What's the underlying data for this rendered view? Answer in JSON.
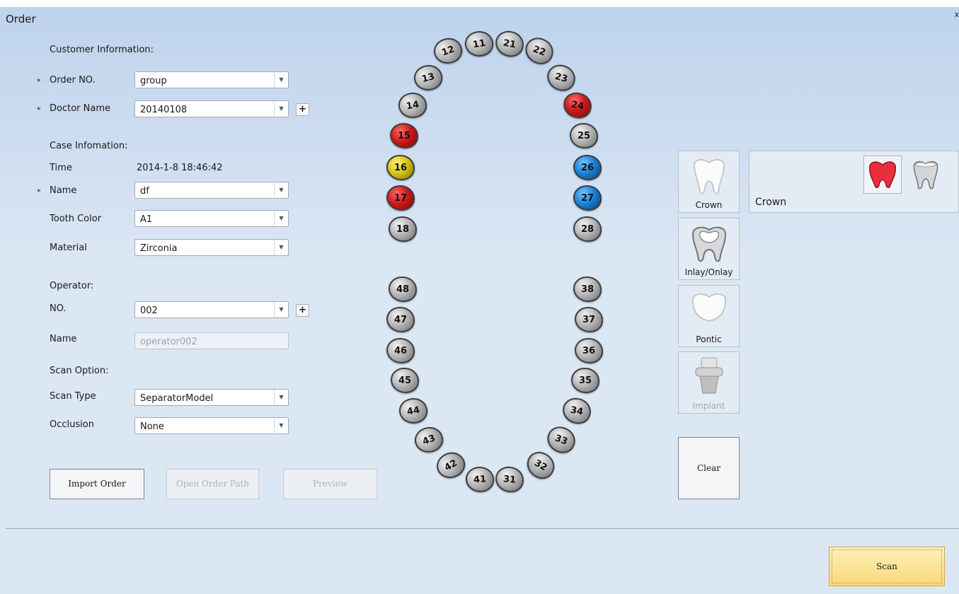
{
  "window": {
    "title": "Order",
    "close_label": "x"
  },
  "customer": {
    "section": "Customer Information:",
    "order_no_label": "Order NO.",
    "order_no_value": "group",
    "doctor_label": "Doctor Name",
    "doctor_value": "20140108"
  },
  "case": {
    "section": "Case Infomation:",
    "time_label": "Time",
    "time_value": "2014-1-8 18:46:42",
    "name_label": "Name",
    "name_value": "df",
    "tooth_color_label": "Tooth Color",
    "tooth_color_value": "A1",
    "material_label": "Material",
    "material_value": "Zirconia"
  },
  "operator": {
    "section": "Operator:",
    "no_label": "NO.",
    "no_value": "002",
    "name_label": "Name",
    "name_value": "operator002"
  },
  "scan_option": {
    "section": "Scan Option:",
    "type_label": "Scan Type",
    "type_value": "SeparatorModel",
    "occlusion_label": "Occlusion",
    "occlusion_value": "None"
  },
  "symbols": {
    "required": "*",
    "plus": "+",
    "dropdown": "▼"
  },
  "buttons": {
    "import": "Import Order",
    "open_path": "Open Order Path",
    "preview": "Preview",
    "clear": "Clear",
    "scan": "Scan"
  },
  "teeth": [
    {
      "n": "11",
      "state": "normal"
    },
    {
      "n": "12",
      "state": "normal"
    },
    {
      "n": "13",
      "state": "normal"
    },
    {
      "n": "14",
      "state": "normal"
    },
    {
      "n": "15",
      "state": "red"
    },
    {
      "n": "16",
      "state": "yellow"
    },
    {
      "n": "17",
      "state": "red"
    },
    {
      "n": "18",
      "state": "normal"
    },
    {
      "n": "21",
      "state": "normal"
    },
    {
      "n": "22",
      "state": "normal"
    },
    {
      "n": "23",
      "state": "normal"
    },
    {
      "n": "24",
      "state": "red"
    },
    {
      "n": "25",
      "state": "normal"
    },
    {
      "n": "26",
      "state": "blue"
    },
    {
      "n": "27",
      "state": "blue"
    },
    {
      "n": "28",
      "state": "normal"
    },
    {
      "n": "48",
      "state": "normal"
    },
    {
      "n": "47",
      "state": "normal"
    },
    {
      "n": "46",
      "state": "normal"
    },
    {
      "n": "45",
      "state": "normal"
    },
    {
      "n": "44",
      "state": "normal"
    },
    {
      "n": "43",
      "state": "normal"
    },
    {
      "n": "42",
      "state": "normal"
    },
    {
      "n": "41",
      "state": "normal"
    },
    {
      "n": "38",
      "state": "normal"
    },
    {
      "n": "37",
      "state": "normal"
    },
    {
      "n": "36",
      "state": "normal"
    },
    {
      "n": "35",
      "state": "normal"
    },
    {
      "n": "34",
      "state": "normal"
    },
    {
      "n": "33",
      "state": "normal"
    },
    {
      "n": "32",
      "state": "normal"
    },
    {
      "n": "31",
      "state": "normal"
    }
  ],
  "restoration_types": [
    "Crown",
    "Inlay/Onlay",
    "Pontic",
    "Implant"
  ],
  "panel": {
    "title": "Crown"
  },
  "colors": {
    "red": "#d01818",
    "yellow": "#d8c515",
    "blue": "#1a84d6",
    "scan_bg": "#f8d978"
  }
}
